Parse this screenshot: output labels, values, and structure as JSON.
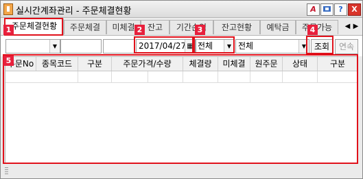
{
  "window": {
    "title": "실시간계좌관리 - 주문체결현황",
    "buttons": {
      "a_label": "A",
      "help_label": "?",
      "close_label": "X"
    }
  },
  "tabs": [
    "주문체결현황",
    "주문체결",
    "미체결",
    "잔고",
    "기간손익",
    "잔고현황",
    "예탁금",
    "주문가능"
  ],
  "toolbar": {
    "date": "2017/04/27",
    "filter1": "전체",
    "filter2": "전체",
    "search_label": "조회",
    "continue_label": "연속"
  },
  "grid": {
    "columns": [
      "주문No",
      "종목코드",
      "구분",
      "주문가격/수량",
      "체결량",
      "미체결",
      "원주문",
      "상태",
      "구분"
    ]
  },
  "badges": [
    "1",
    "2",
    "3",
    "4",
    "5"
  ],
  "colors": {
    "annotation": "#e0101a",
    "badge": "#e8203c"
  }
}
